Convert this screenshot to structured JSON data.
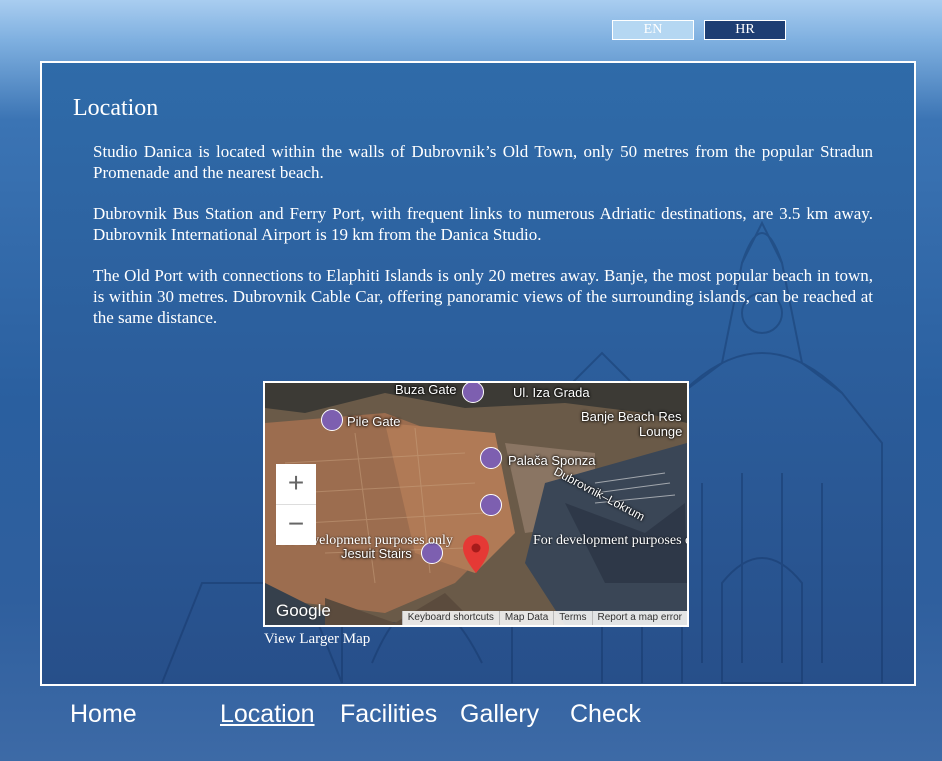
{
  "lang": {
    "en": "EN",
    "hr": "HR"
  },
  "section": {
    "title": "Location",
    "paragraphs": [
      "Studio Danica is located within the walls of Dubrovnik’s Old Town, only 50 metres from the popular Stradun Promenade and the nearest beach.",
      "Dubrovnik Bus Station and Ferry Port, with frequent links to numerous Adriatic destinations, are 3.5 km away. Dubrovnik International Airport is 19 km from the Danica Studio.",
      "The Old Port with connections to Elaphiti Islands is only 20 metres away. Banje, the most popular beach in town, is within 30 metres. Dubrovnik Cable Car, offering panoramic views of the surrounding islands, can be reached at the same distance."
    ]
  },
  "map": {
    "labels": {
      "buza_gate": "Buza Gate",
      "ul_iza_grada": "Ul. Iza Grada",
      "pile_gate": "Pile Gate",
      "banje_beach": "Banje Beach Res",
      "lounge": "Lounge",
      "palaca_sponza": "Palača Sponza",
      "dubrovnik_lokrum": "Dubrovnik–Lokrum",
      "jesuit_stairs": "Jesuit Stairs"
    },
    "dev_notice": "For development purposes only",
    "zoom_in": "+",
    "zoom_out": "−",
    "brand": "Google",
    "footer": {
      "shortcuts": "Keyboard shortcuts",
      "map_data": "Map Data",
      "terms": "Terms",
      "report": "Report a map error"
    },
    "view_larger": "View Larger Map"
  },
  "nav": {
    "home": "Home",
    "location": "Location",
    "facilities": "Facilities",
    "gallery": "Gallery",
    "check": "Check"
  },
  "colors": {
    "panel": "#2c5f9d",
    "lang_active": "#1e3e73",
    "lang_inactive": "#b5d7f2",
    "poi": "#7d5fb0",
    "marker": "#e53935"
  }
}
